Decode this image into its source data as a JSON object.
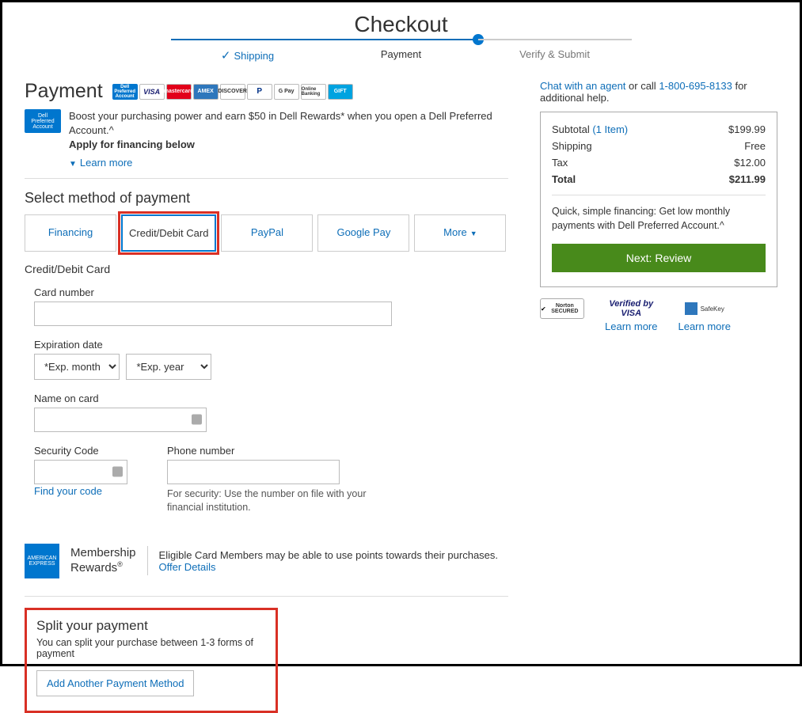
{
  "page_title": "Checkout",
  "stepper": {
    "shipping": "Shipping",
    "payment": "Payment",
    "verify": "Verify & Submit"
  },
  "left": {
    "heading": "Payment",
    "card_icons": {
      "dpa": "Dell Preferred Account",
      "visa": "VISA",
      "mc": "mastercard",
      "amex": "AMEX",
      "discover": "DISCOVER",
      "paypal": "P",
      "gpay": "G Pay",
      "online_banking": "Online Banking",
      "gift": "GIFT"
    },
    "dpa_badge": "Dell Preferred Account",
    "promo_line": "Boost your purchasing power and earn $50 in Dell Rewards* when you open a Dell Preferred Account.^",
    "promo_bold": "Apply for financing below",
    "learn_more": "Learn more",
    "select_method": "Select method of payment",
    "tabs": {
      "financing": "Financing",
      "credit": "Credit/Debit Card",
      "paypal": "PayPal",
      "gpay": "Google Pay",
      "more": "More"
    },
    "cc_title": "Credit/Debit Card",
    "labels": {
      "card_number": "Card number",
      "expiration": "Expiration date",
      "exp_month": "*Exp. month",
      "exp_year": "*Exp. year",
      "name": "Name on card",
      "security": "Security Code",
      "find_code": "Find your code",
      "phone": "Phone number",
      "phone_help": "For security: Use the number on file with your financial institution."
    },
    "amex": {
      "badge": "AMERICAN EXPRESS",
      "title_l1": "Membership",
      "title_l2": "Rewards",
      "desc": "Eligible Card Members may be able to use points towards their purchases. ",
      "link": "Offer Details"
    },
    "split": {
      "title": "Split your payment",
      "desc": "You can split your purchase between 1-3 forms of payment",
      "button": "Add Another Payment Method"
    }
  },
  "right": {
    "help_pre": "Chat with an agent",
    "help_mid": " or call ",
    "help_phone": "1-800-695-8133",
    "help_post": " for additional help.",
    "summary": {
      "subtotal_label": "Subtotal ",
      "subtotal_items": "(1 Item)",
      "subtotal_value": "$199.99",
      "shipping_label": "Shipping",
      "shipping_value": "Free",
      "tax_label": "Tax",
      "tax_value": "$12.00",
      "total_label": "Total",
      "total_value": "$211.99"
    },
    "financing_note": "Quick, simple financing: Get low monthly payments with Dell Preferred Account.^",
    "next_button": "Next: Review",
    "badges": {
      "norton": "Norton SECURED",
      "visa": "Verified by VISA",
      "safekey": "SafeKey",
      "learn_more": "Learn more"
    }
  }
}
